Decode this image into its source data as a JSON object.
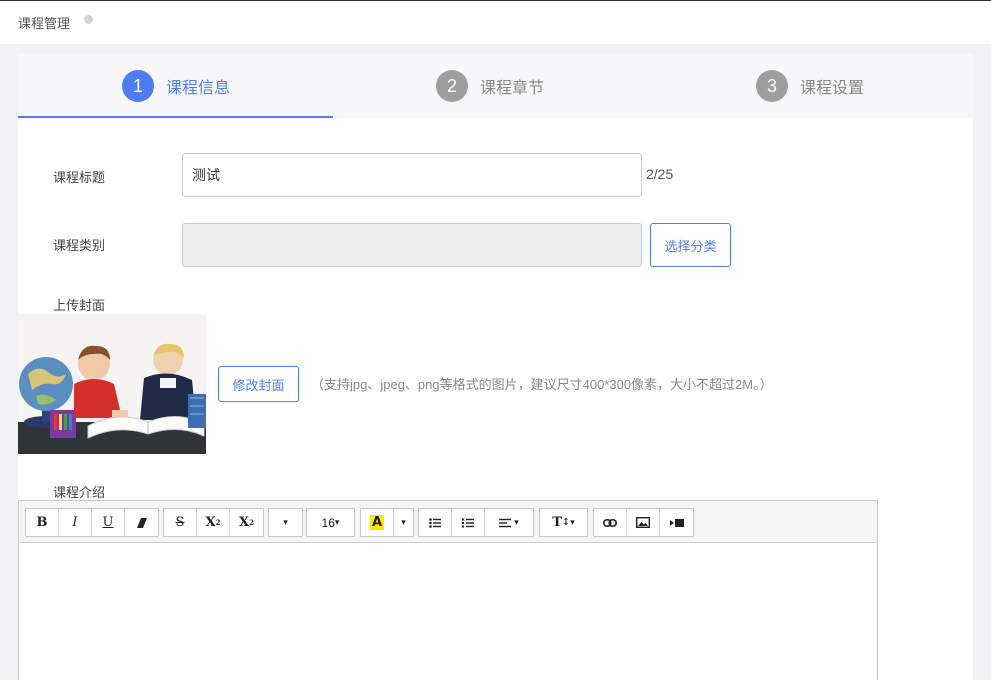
{
  "header": {
    "title": "课程管理"
  },
  "steps": [
    {
      "num": "1",
      "label": "课程信息",
      "active": true
    },
    {
      "num": "2",
      "label": "课程章节",
      "active": false
    },
    {
      "num": "3",
      "label": "课程设置",
      "active": false
    }
  ],
  "form": {
    "title_label": "课程标题",
    "title_value": "测试",
    "title_counter": "2/25",
    "category_label": "课程类别",
    "category_button": "选择分类",
    "cover_label": "上传封面",
    "cover_button": "修改封面",
    "cover_hint": "（支持jpg、jpeg、png等格式的图片，建议尺寸400*300像素，大小不超过2M。）",
    "intro_label": "课程介绍"
  },
  "editor": {
    "bold": "B",
    "italic": "I",
    "underline": "U",
    "strike": "S",
    "superscript": "X",
    "sup_mark": "2",
    "subscript": "X",
    "sub_mark": "2",
    "font_size": "16",
    "highlight": "A",
    "text_type": "T"
  },
  "colors": {
    "accent": "#4d7cf4",
    "step_inactive": "#9e9e9e",
    "highlight_yellow": "#ffe600"
  }
}
